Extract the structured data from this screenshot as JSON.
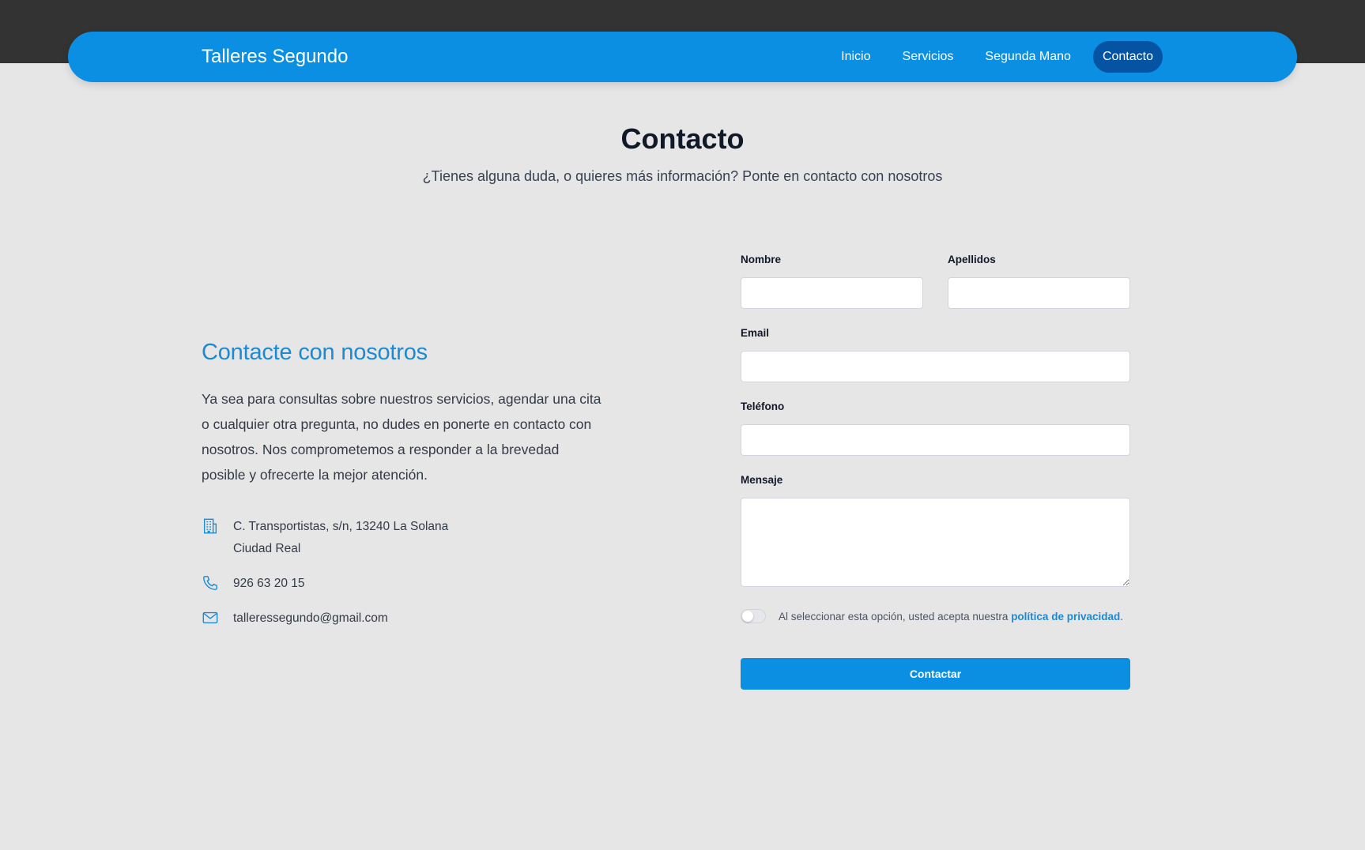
{
  "nav": {
    "brand": "Talleres Segundo",
    "links": [
      {
        "label": "Inicio"
      },
      {
        "label": "Servicios"
      },
      {
        "label": "Segunda Mano"
      },
      {
        "label": "Contacto",
        "active": true
      }
    ]
  },
  "header": {
    "title": "Contacto",
    "subtitle": "¿Tienes alguna duda, o quieres más información? Ponte en contacto con nosotros"
  },
  "contact_info": {
    "heading": "Contacte con nosotros",
    "text": "Ya sea para consultas sobre nuestros servicios, agendar una cita o cualquier otra pregunta, no dudes en ponerte en contacto con nosotros. Nos comprometemos a responder a la brevedad posible y ofrecerte la mejor atención.",
    "address_line1": "C. Transportistas, s/n, 13240 La Solana",
    "address_line2": "Ciudad Real",
    "phone": "926 63 20 15",
    "email": "talleressegundo@gmail.com",
    "icons": {
      "address": "building-icon",
      "phone": "phone-icon",
      "email": "mail-icon"
    }
  },
  "form": {
    "nombre_label": "Nombre",
    "nombre_value": "",
    "apellidos_label": "Apellidos",
    "apellidos_value": "",
    "email_label": "Email",
    "email_value": "",
    "telefono_label": "Teléfono",
    "telefono_value": "",
    "mensaje_label": "Mensaje",
    "mensaje_value": "",
    "consent_text": "Al seleccionar esta opción, usted acepta nuestra ",
    "consent_link": "política de privacidad",
    "consent_end": ".",
    "consent_checked": false,
    "submit_label": "Contactar"
  },
  "colors": {
    "primary": "#0b8fe3",
    "active_nav": "#0454a3",
    "accent_text": "#1a8ad3",
    "background": "#e6e6e7",
    "top_band": "#333333"
  }
}
